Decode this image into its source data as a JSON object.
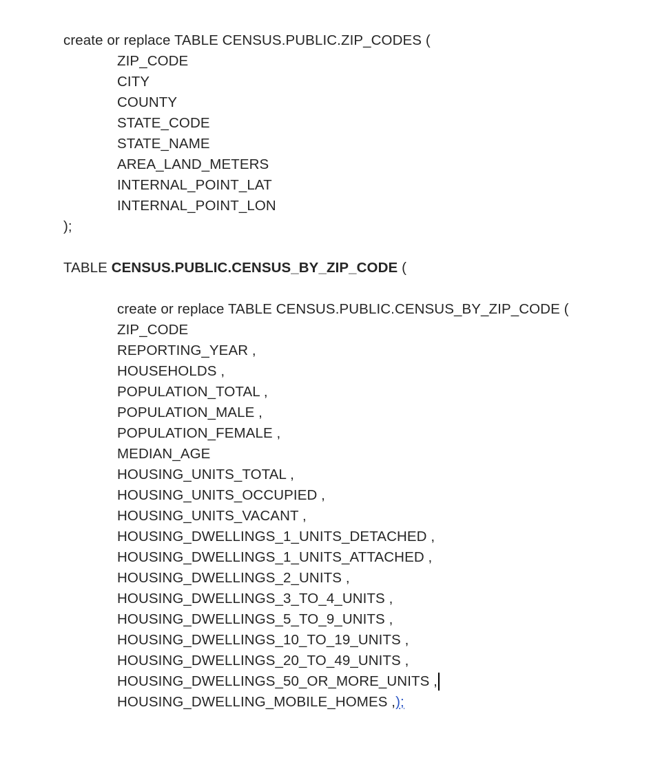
{
  "zip_codes_block": {
    "header": "create or replace TABLE CENSUS.PUBLIC.ZIP_CODES (",
    "columns": [
      "ZIP_CODE",
      "CITY",
      "COUNTY",
      "STATE_CODE",
      "STATE_NAME",
      "AREA_LAND_METERS",
      "INTERNAL_POINT_LAT",
      "INTERNAL_POINT_LON"
    ],
    "footer": ");"
  },
  "census_block": {
    "title_prefix": "TABLE ",
    "title_bold": "CENSUS.PUBLIC.CENSUS_BY_ZIP_CODE",
    "title_suffix": " (",
    "header": "create or replace TABLE CENSUS.PUBLIC.CENSUS_BY_ZIP_CODE (",
    "columns": [
      "ZIP_CODE",
      "REPORTING_YEAR ,",
      "HOUSEHOLDS ,",
      "POPULATION_TOTAL ,",
      "POPULATION_MALE ,",
      "POPULATION_FEMALE ,",
      "MEDIAN_AGE",
      "HOUSING_UNITS_TOTAL ,",
      "HOUSING_UNITS_OCCUPIED ,",
      "HOUSING_UNITS_VACANT ,",
      "HOUSING_DWELLINGS_1_UNITS_DETACHED ,",
      "HOUSING_DWELLINGS_1_UNITS_ATTACHED ,",
      "HOUSING_DWELLINGS_2_UNITS ,",
      "HOUSING_DWELLINGS_3_TO_4_UNITS ,",
      "HOUSING_DWELLINGS_5_TO_9_UNITS ,",
      "HOUSING_DWELLINGS_10_TO_19_UNITS ,",
      "HOUSING_DWELLINGS_20_TO_49_UNITS ,",
      "HOUSING_DWELLINGS_50_OR_MORE_UNITS ,"
    ],
    "last_column": "HOUSING_DWELLING_MOBILE_HOMES ,",
    "last_column_closing": ");"
  },
  "colors": {
    "text": "#262626",
    "link": "#2a55c4"
  }
}
